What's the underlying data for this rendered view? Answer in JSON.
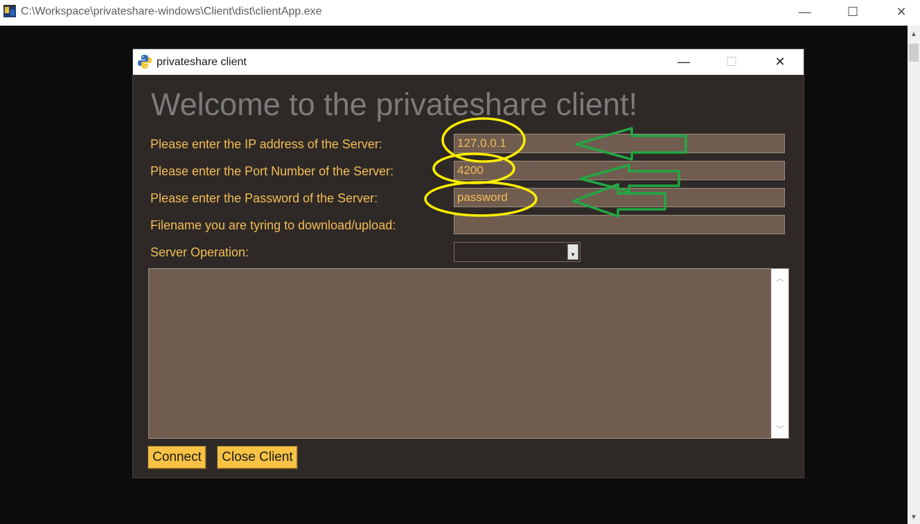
{
  "outer_window": {
    "title": "C:\\Workspace\\privateshare-windows\\Client\\dist\\clientApp.exe",
    "controls": {
      "minimize": "—",
      "maximize": "☐",
      "close": "✕"
    }
  },
  "client_window": {
    "title": "privateshare client",
    "controls": {
      "minimize": "—",
      "maximize": "☐",
      "close": "✕"
    },
    "welcome": "Welcome to the privateshare client!",
    "fields": {
      "ip": {
        "label": "Please enter the IP address of the Server:",
        "value": "127.0.0.1"
      },
      "port": {
        "label": "Please enter the Port Number of the Server:",
        "value": "4200"
      },
      "password": {
        "label": "Please enter the Password of the Server:",
        "value": "password"
      },
      "filename": {
        "label": "Filename you are tyring to download/upload:",
        "value": ""
      }
    },
    "operation": {
      "label": "Server Operation:",
      "selected": ""
    },
    "output_text": "",
    "buttons": {
      "connect": "Connect",
      "close": "Close Client"
    }
  },
  "colors": {
    "window_bg": "#2e2926",
    "entry_bg": "#705d50",
    "label_text": "#f3bd55",
    "button_bg": "#f8c244",
    "annotation_circle": "#ffee00",
    "annotation_arrow": "#22a844"
  }
}
